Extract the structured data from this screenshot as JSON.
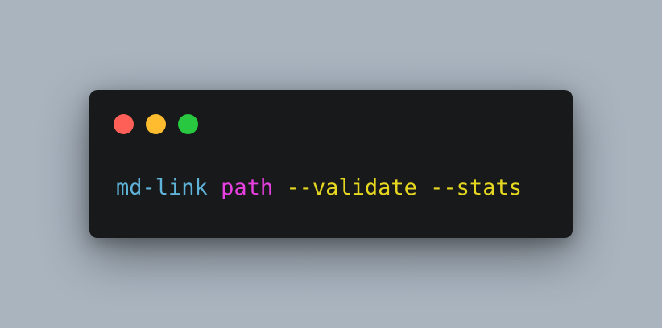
{
  "window": {
    "controls": [
      {
        "name": "close",
        "color": "#fe5f57"
      },
      {
        "name": "minimize",
        "color": "#febc2e"
      },
      {
        "name": "maximize",
        "color": "#28c840"
      }
    ]
  },
  "code": {
    "command": "md-link",
    "argument": "path",
    "flags": "--validate --stats",
    "colors": {
      "command": "#5fb3d9",
      "argument": "#e83fe0",
      "flags": "#e6d820"
    }
  }
}
